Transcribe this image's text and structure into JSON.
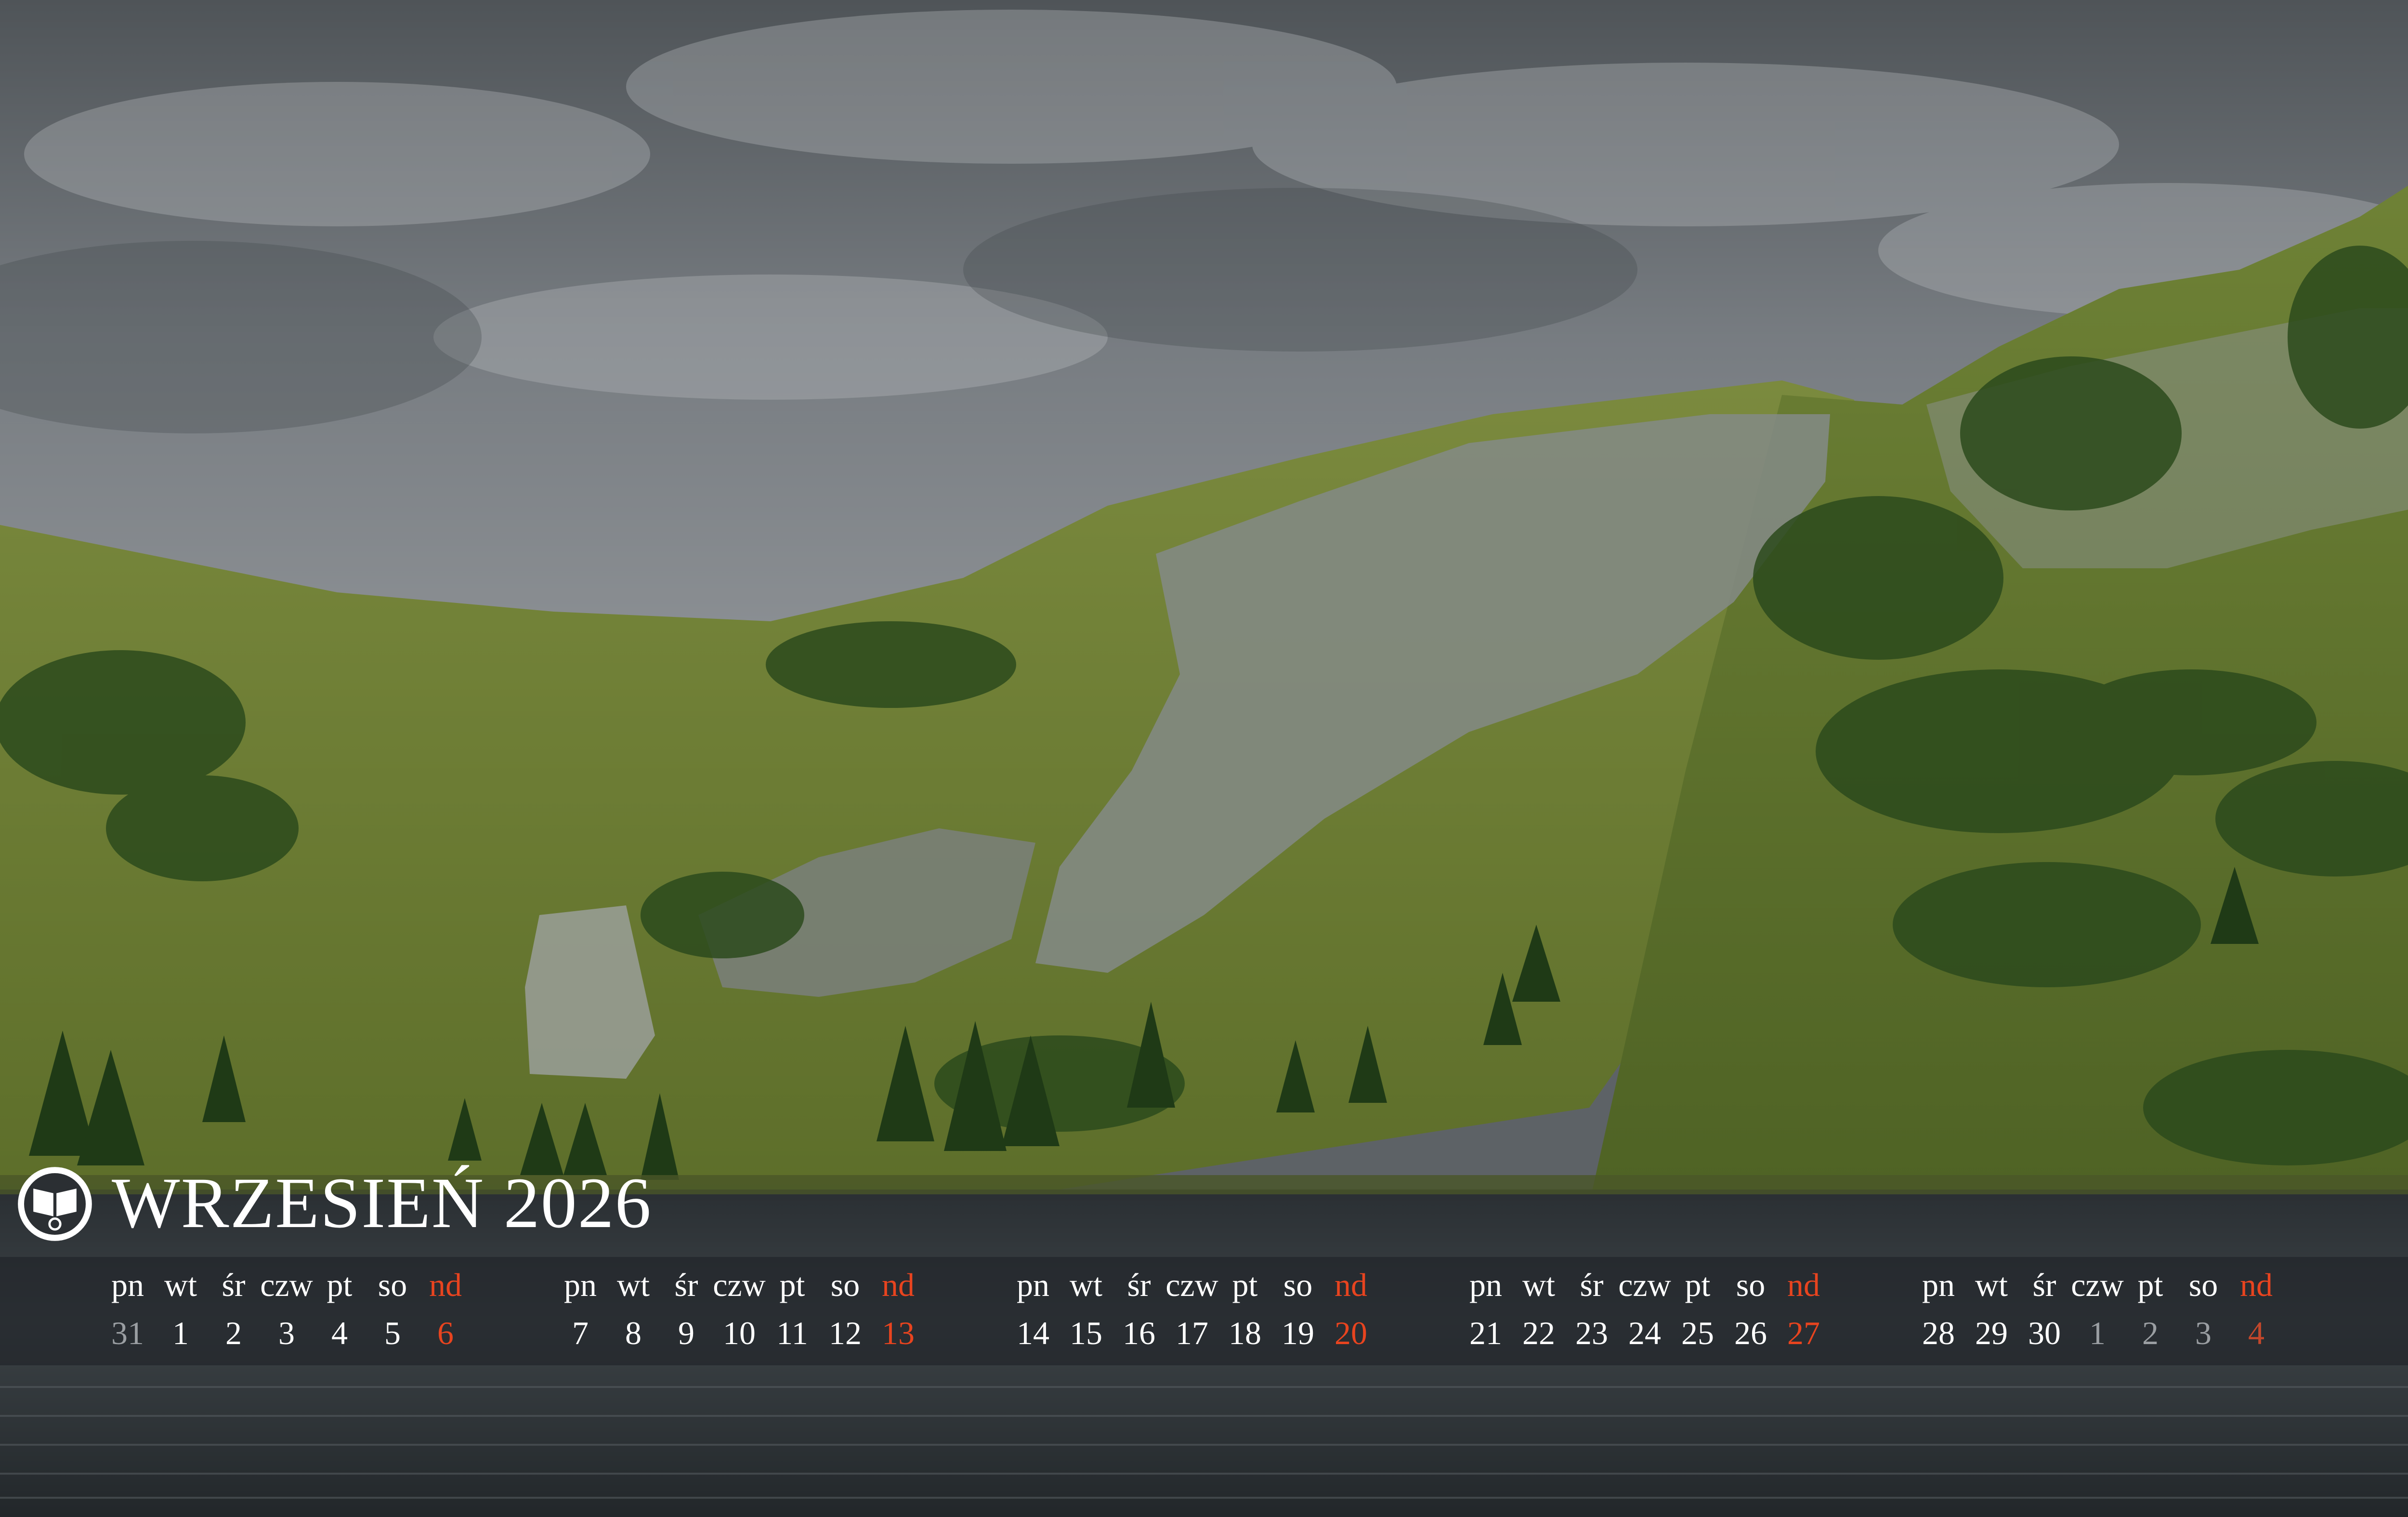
{
  "calendar": {
    "month_label": "WRZESIEŃ 2026",
    "weekday_headers": [
      "pn",
      "wt",
      "śr",
      "czw",
      "pt",
      "so",
      "nd"
    ],
    "weeks": [
      {
        "days": [
          "31",
          "1",
          "2",
          "3",
          "4",
          "5",
          "6"
        ],
        "outside_month": [
          true,
          false,
          false,
          false,
          false,
          false,
          false
        ]
      },
      {
        "days": [
          "7",
          "8",
          "9",
          "10",
          "11",
          "12",
          "13"
        ],
        "outside_month": [
          false,
          false,
          false,
          false,
          false,
          false,
          false
        ]
      },
      {
        "days": [
          "14",
          "15",
          "16",
          "17",
          "18",
          "19",
          "20"
        ],
        "outside_month": [
          false,
          false,
          false,
          false,
          false,
          false,
          false
        ]
      },
      {
        "days": [
          "21",
          "22",
          "23",
          "24",
          "25",
          "26",
          "27"
        ],
        "outside_month": [
          false,
          false,
          false,
          false,
          false,
          false,
          false
        ]
      },
      {
        "days": [
          "28",
          "29",
          "30",
          "1",
          "2",
          "3",
          "4"
        ],
        "outside_month": [
          false,
          false,
          false,
          true,
          true,
          true,
          true
        ]
      }
    ]
  },
  "colors": {
    "text": "#ffffff",
    "sunday": "#e8441f",
    "outside_month": "#9a9ea2",
    "band": "#1e2226"
  },
  "photo": {
    "subject": "mountain-lake-landscape"
  }
}
